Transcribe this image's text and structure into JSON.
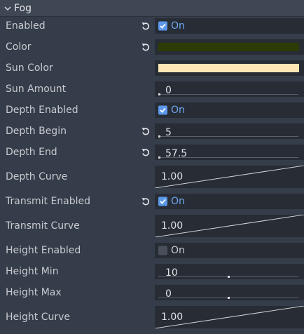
{
  "section": {
    "title": "Fog"
  },
  "properties": [
    {
      "label": "Enabled",
      "type": "checkbox",
      "checked": true,
      "value_text": "On",
      "revert": true
    },
    {
      "label": "Color",
      "type": "color",
      "color": "#2b3d05",
      "revert": true
    },
    {
      "label": "Sun Color",
      "type": "color",
      "color": "#ffe6b4",
      "revert": false
    },
    {
      "label": "Sun Amount",
      "type": "slider",
      "value_text": "0",
      "revert": false
    },
    {
      "label": "Depth Enabled",
      "type": "checkbox",
      "checked": true,
      "value_text": "On",
      "revert": false
    },
    {
      "label": "Depth Begin",
      "type": "slider",
      "value_text": "5",
      "revert": true
    },
    {
      "label": "Depth End",
      "type": "slider",
      "value_text": "57.5",
      "revert": true
    },
    {
      "label": "Depth Curve",
      "type": "curve",
      "value_text": "1.00",
      "revert": false
    },
    {
      "label": "Transmit Enabled",
      "type": "checkbox",
      "checked": true,
      "value_text": "On",
      "revert": true
    },
    {
      "label": "Transmit Curve",
      "type": "curve",
      "value_text": "1.00",
      "revert": false
    },
    {
      "label": "Height Enabled",
      "type": "checkbox",
      "checked": false,
      "value_text": "On",
      "revert": false
    },
    {
      "label": "Height Min",
      "type": "slider",
      "value_text": "10",
      "revert": false
    },
    {
      "label": "Height Max",
      "type": "slider",
      "value_text": "0",
      "revert": false
    },
    {
      "label": "Height Curve",
      "type": "curve",
      "value_text": "1.00",
      "revert": false
    }
  ],
  "icons": {
    "section_toggle": "chevron-down-icon",
    "revert": "revert-icon"
  },
  "colors": {
    "accent": "#5c98ea",
    "on_text": "#6fa7f1"
  }
}
